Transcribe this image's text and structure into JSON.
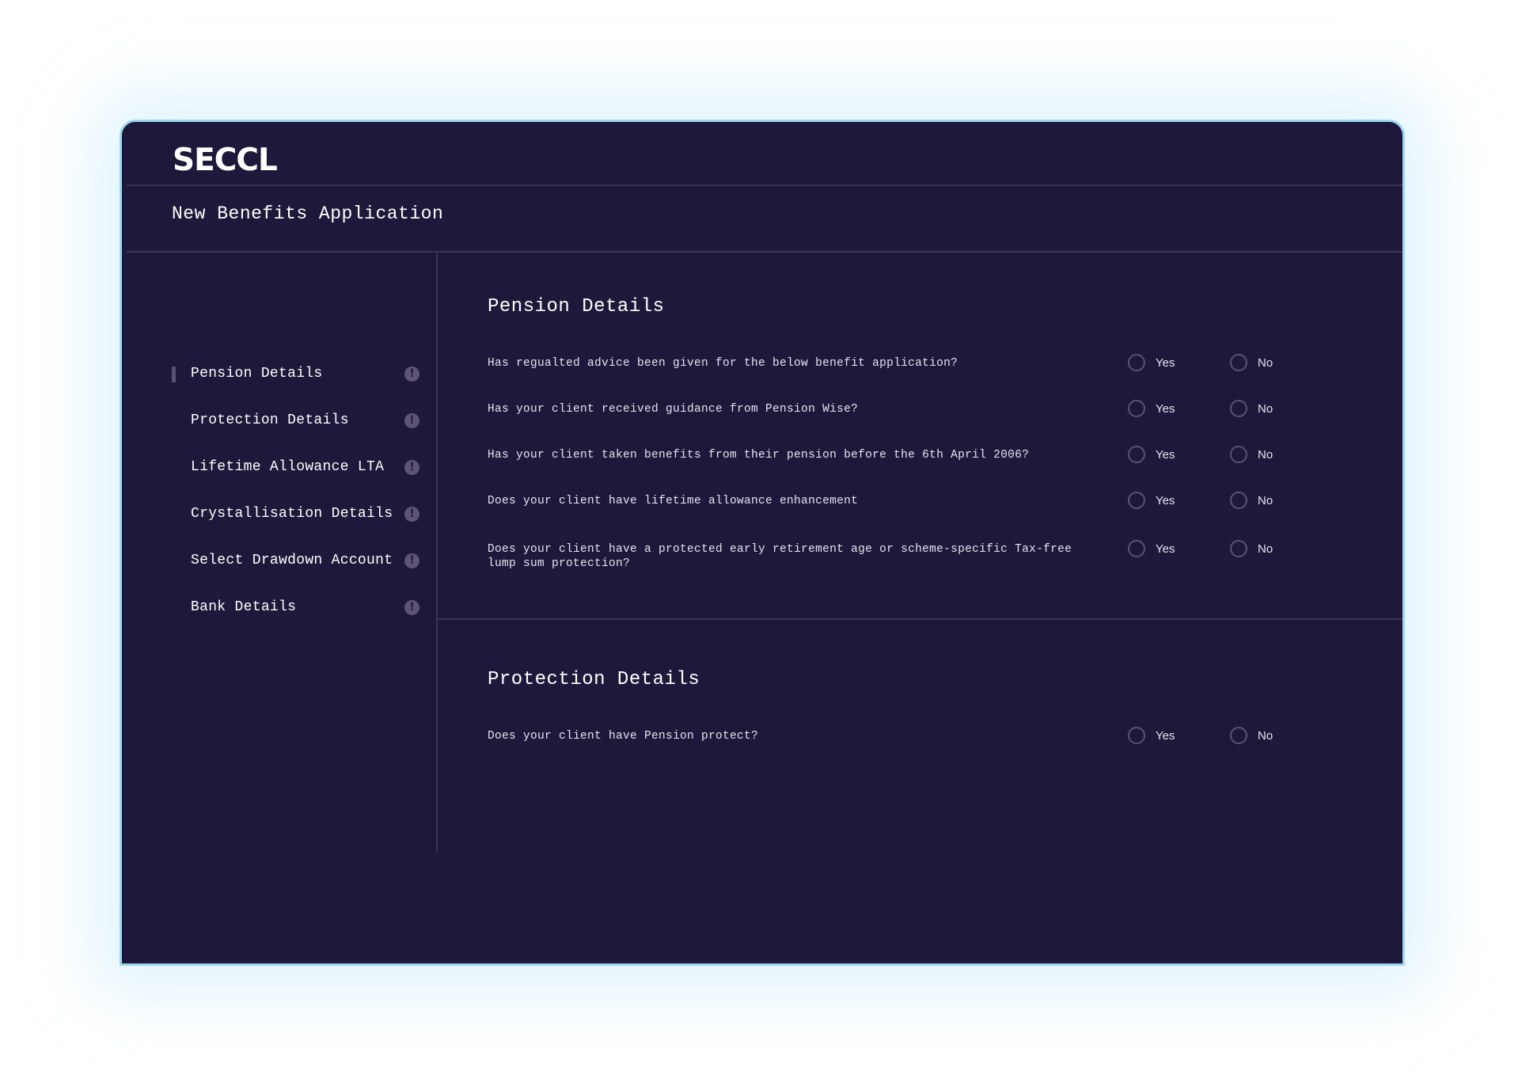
{
  "brand": {
    "logo": "SECCL"
  },
  "header": {
    "title": "New Benefits Application"
  },
  "sidebar": {
    "items": [
      {
        "label": "Pension Details",
        "active": true
      },
      {
        "label": "Protection Details",
        "active": false
      },
      {
        "label": "Lifetime Allowance LTA",
        "active": false
      },
      {
        "label": "Crystallisation Details",
        "active": false
      },
      {
        "label": "Select Drawdown Account",
        "active": false
      },
      {
        "label": "Bank Details",
        "active": false
      }
    ],
    "warning_icon_glyph": "!"
  },
  "sections": [
    {
      "title": "Pension Details",
      "questions": [
        {
          "text": "Has regualted advice been given for the below benefit application?"
        },
        {
          "text": "Has your client received guidance from Pension Wise?"
        },
        {
          "text": "Has your client taken benefits from their pension before the 6th April 2006?"
        },
        {
          "text": "Does your client have lifetime allowance enhancement"
        },
        {
          "text": "Does your client have a protected early retirement age or scheme-specific Tax-free lump sum protection?"
        }
      ]
    },
    {
      "title": "Protection Details",
      "questions": [
        {
          "text": "Does your client have Pension protect?"
        }
      ]
    }
  ],
  "options": {
    "yes": "Yes",
    "no": "No"
  },
  "colors": {
    "background": "#1e193a",
    "border_accent": "#9fd8f2",
    "divider": "#3a3454",
    "muted_icon": "#5e5478"
  }
}
